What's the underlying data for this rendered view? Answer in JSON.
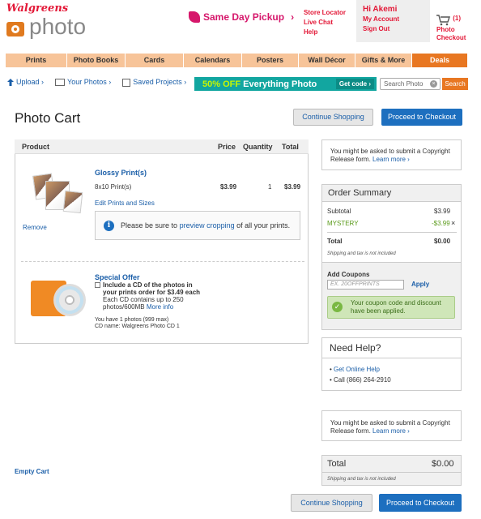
{
  "header": {
    "logo_brand": "Walgreens",
    "logo_photo": "photo",
    "same_day": "Same Day Pickup",
    "same_day_chevron": "›",
    "links": [
      "Store Locator",
      "Live Chat",
      "Help"
    ],
    "greeting": "Hi Akemi",
    "account_links": [
      "My Account",
      "Sign Out"
    ],
    "cart_count": "(1)",
    "cart_label": "Photo Checkout"
  },
  "nav": [
    "Prints",
    "Photo Books",
    "Cards",
    "Calendars",
    "Posters",
    "Wall Décor",
    "Gifts & More",
    "Deals"
  ],
  "subnav": {
    "upload": "Upload ›",
    "your_photos": "Your Photos ›",
    "saved_projects": "Saved Projects ›"
  },
  "promo": {
    "off": "50% OFF",
    "rest": "Everything Photo",
    "code": "Get code ›"
  },
  "search": {
    "placeholder": "Search Photo",
    "button": "Search"
  },
  "page": {
    "title": "Photo Cart",
    "continue": "Continue Shopping",
    "checkout": "Proceed to Checkout",
    "empty": "Empty Cart"
  },
  "table": {
    "headers": [
      "Product",
      "Price",
      "Quantity",
      "Total"
    ]
  },
  "item": {
    "name": "Glossy Print(s)",
    "size": "8x10 Print(s)",
    "price": "$3.99",
    "qty": "1",
    "total": "$3.99",
    "edit": "Edit Prints and Sizes",
    "remove": "Remove",
    "note_pre": "Please be sure to",
    "note_link": "preview cropping",
    "note_post": "of all your prints."
  },
  "offer": {
    "title": "Special Offer",
    "line1": "Include a CD of the photos in",
    "line2": "your prints order for $3.49 each",
    "line3": "Each CD contains up to 250",
    "line4": "photos/600MB",
    "more": "More info",
    "count": "You have 1 photos (999 max)",
    "cdname": "CD name: Walgreens Photo CD 1"
  },
  "copyright": {
    "text": "You might be asked to submit a Copyright Release form.",
    "link": "Learn more ›"
  },
  "summary": {
    "title": "Order Summary",
    "subtotal_label": "Subtotal",
    "subtotal": "$3.99",
    "mystery_label": "MYSTERY",
    "mystery": "-$3.99",
    "remove_x": "×",
    "total_label": "Total",
    "total": "$0.00",
    "ship_note": "Shipping and tax is not included"
  },
  "coupon": {
    "label": "Add Coupons",
    "placeholder": "EX. 20OFFPRINTS",
    "apply": "Apply",
    "success": "Your coupon code and discount have been applied.",
    "check": "✓"
  },
  "help": {
    "title": "Need Help?",
    "online": "Get Online Help",
    "call": "Call (866) 264-2910"
  },
  "bottom_total": {
    "label": "Total",
    "value": "$0.00",
    "note": "Shipping and tax is not included"
  },
  "colors": {
    "brand_red": "#e31837",
    "accent_orange": "#e87722",
    "checkout_blue": "#1d6fbf",
    "promo_teal": "#12a6a0",
    "mystery_green": "#5a9a1a"
  }
}
